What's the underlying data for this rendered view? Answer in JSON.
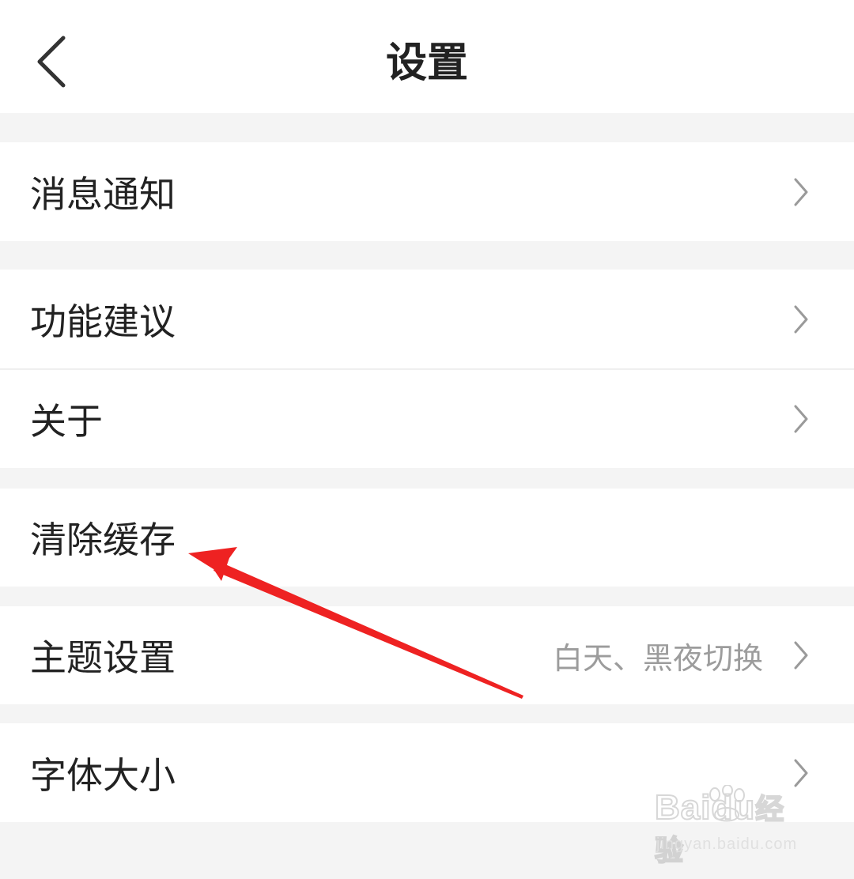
{
  "header": {
    "title": "设置",
    "back_icon": "chevron-left-icon"
  },
  "settings": {
    "items": [
      {
        "label": "消息通知",
        "value": "",
        "has_chevron": true
      },
      {
        "label": "功能建议",
        "value": "",
        "has_chevron": true
      },
      {
        "label": "关于",
        "value": "",
        "has_chevron": true
      },
      {
        "label": "清除缓存",
        "value": "",
        "has_chevron": false
      },
      {
        "label": "主题设置",
        "value": "白天、黑夜切换",
        "has_chevron": true
      },
      {
        "label": "字体大小",
        "value": "",
        "has_chevron": true
      }
    ]
  },
  "annotation": {
    "arrow_color": "#ee2222",
    "points_to": "清除缓存"
  },
  "watermark": {
    "brand": "Bai",
    "brand_suffix": "du",
    "product": "经验",
    "url": "jingyan.baidu.com"
  },
  "colors": {
    "background": "#f4f4f4",
    "surface": "#ffffff",
    "text": "#222222",
    "secondary_text": "#9c9c9c",
    "chevron": "#9a9a9a"
  }
}
